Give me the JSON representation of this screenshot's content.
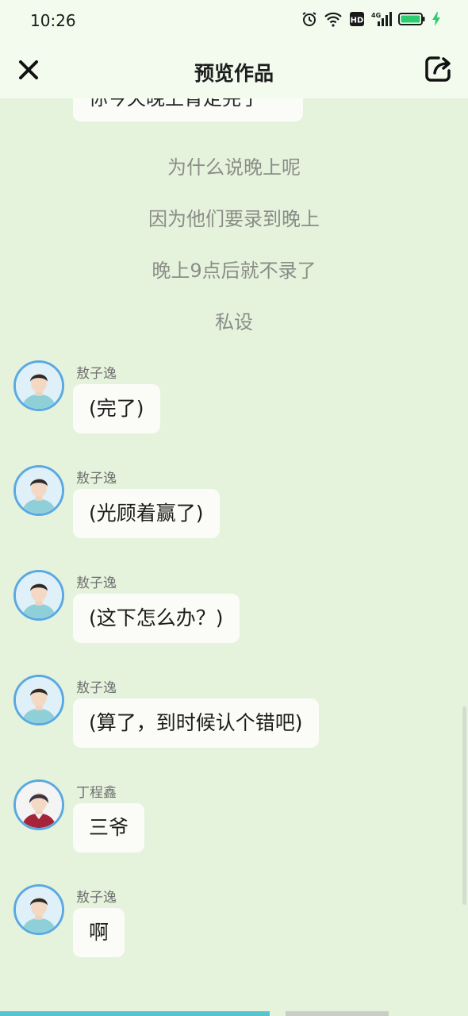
{
  "status_bar": {
    "time": "10:26",
    "icons": [
      "alarm-icon",
      "wifi-icon",
      "hd-icon",
      "4g-signal-icon",
      "battery-icon",
      "charging-icon"
    ],
    "hd_label": "HD",
    "network_label": "4G"
  },
  "header": {
    "title": "预览作品",
    "left_icon": "close-icon",
    "right_icon": "share-icon"
  },
  "chat": {
    "partial_message": "你今天晚上肯定完了",
    "narrations": [
      "为什么说晚上呢",
      "因为他们要录到晚上",
      "晚上9点后就不录了",
      "私设"
    ],
    "messages": [
      {
        "sender": "敖子逸",
        "text": "(完了)"
      },
      {
        "sender": "敖子逸",
        "text": "(光顾着赢了)"
      },
      {
        "sender": "敖子逸",
        "text": "(这下怎么办？)"
      },
      {
        "sender": "敖子逸",
        "text": "(算了，到时候认个错吧)"
      },
      {
        "sender": "丁程鑫",
        "text": "三爷"
      },
      {
        "sender": "敖子逸",
        "text": "啊"
      }
    ]
  },
  "progress": {
    "played_fraction": 0.576,
    "buffered_fraction": 0.61
  },
  "colors": {
    "background": "#e5f3dd",
    "header": "#f3fbef",
    "bubble": "#fbfcf8",
    "avatar_border": "#5aa9e2",
    "narration_text": "#8a8d86",
    "progress_played": "#53c4d0",
    "battery": "#2ecc71"
  }
}
